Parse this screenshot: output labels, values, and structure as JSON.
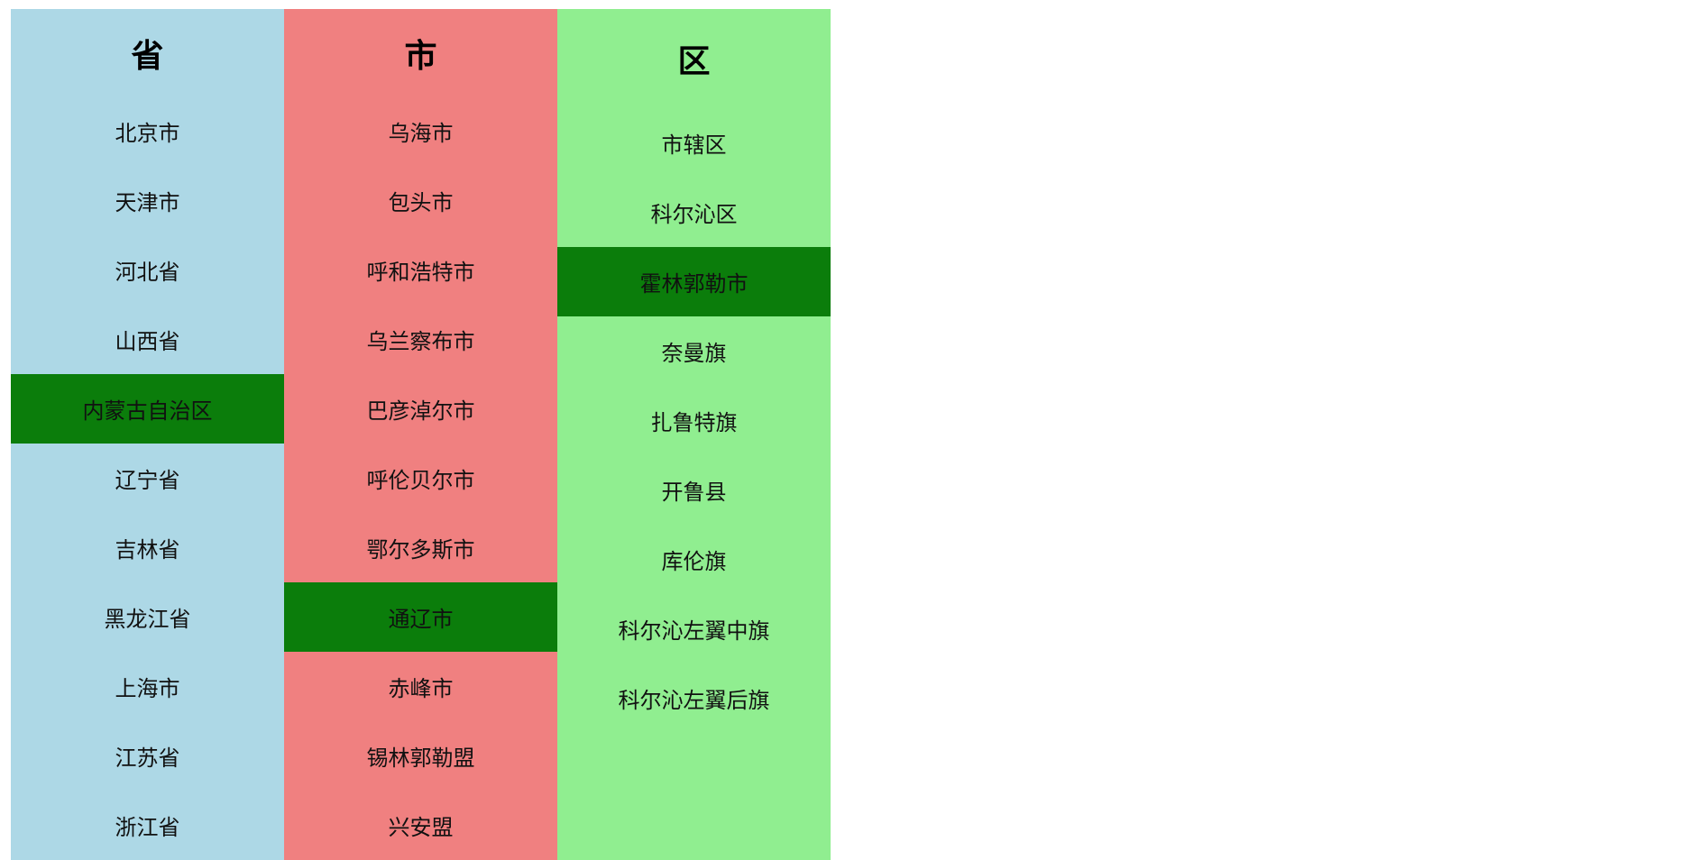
{
  "colors": {
    "province_bg": "#ADD8E6",
    "city_bg": "#F08080",
    "district_bg": "#90EE90",
    "selected_bg": "#0B7D0B"
  },
  "columns": [
    {
      "key": "province",
      "title": "省",
      "selected_index": 4,
      "items": [
        "北京市",
        "天津市",
        "河北省",
        "山西省",
        "内蒙古自治区",
        "辽宁省",
        "吉林省",
        "黑龙江省",
        "上海市",
        "江苏省",
        "浙江省"
      ]
    },
    {
      "key": "city",
      "title": "市",
      "selected_index": 7,
      "items": [
        "乌海市",
        "包头市",
        "呼和浩特市",
        "乌兰察布市",
        "巴彦淖尔市",
        "呼伦贝尔市",
        "鄂尔多斯市",
        "通辽市",
        "赤峰市",
        "锡林郭勒盟",
        "兴安盟"
      ]
    },
    {
      "key": "district",
      "title": "区",
      "selected_index": 2,
      "items": [
        "市辖区",
        "科尔沁区",
        "霍林郭勒市",
        "奈曼旗",
        "扎鲁特旗",
        "开鲁县",
        "库伦旗",
        "科尔沁左翼中旗",
        "科尔沁左翼后旗"
      ]
    }
  ]
}
